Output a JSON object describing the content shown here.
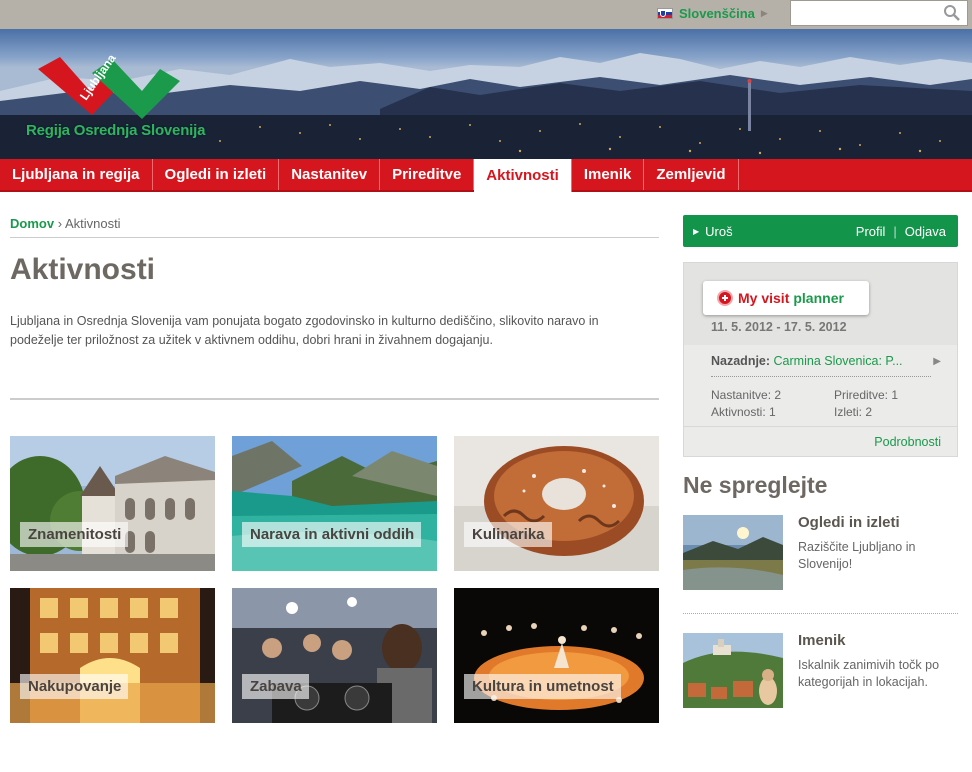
{
  "topbar": {
    "language": "Slovenščina",
    "search_placeholder": ""
  },
  "banner": {
    "logo_word": "Ljubljana",
    "logo_caption": "Regija Osrednja Slovenija"
  },
  "nav": {
    "items": [
      {
        "label": "Ljubljana in regija",
        "active": false
      },
      {
        "label": "Ogledi in izleti",
        "active": false
      },
      {
        "label": "Nastanitev",
        "active": false
      },
      {
        "label": "Prireditve",
        "active": false
      },
      {
        "label": "Aktivnosti",
        "active": true
      },
      {
        "label": "Imenik",
        "active": false
      },
      {
        "label": "Zemljevid",
        "active": false
      }
    ]
  },
  "breadcrumb": {
    "home": "Domov",
    "separator": "›",
    "current": "Aktivnosti"
  },
  "main": {
    "title": "Aktivnosti",
    "intro": "Ljubljana in Osrednja Slovenija vam ponujata bogato zgodovinsko in kulturno dediščino, slikovito naravo in podeželje ter priložnost za užitek v aktivnem oddihu, dobri hrani in živahnem dogajanju.",
    "tiles": [
      {
        "label": "Znamenitosti",
        "image": "building-photo"
      },
      {
        "label": "Narava in aktivni oddih",
        "image": "river-photo"
      },
      {
        "label": "Kulinarika",
        "image": "potica-cake-photo"
      },
      {
        "label": "Nakupovanje",
        "image": "shop-facade-photo"
      },
      {
        "label": "Zabava",
        "image": "dj-party-photo"
      },
      {
        "label": "Kultura in umetnost",
        "image": "dance-stage-photo"
      }
    ]
  },
  "user": {
    "name": "Uroš",
    "profile": "Profil",
    "logout": "Odjava"
  },
  "planner": {
    "brand_red": "My visit",
    "brand_green": "planner",
    "dates": "11. 5. 2012 - 17. 5. 2012",
    "recent_label": "Nazadnje:",
    "recent_value": "Carmina Slovenica: P...",
    "stats": {
      "nastanitve": "Nastanitve: 2",
      "aktivnosti": "Aktivnosti: 1",
      "prireditve": "Prireditve: 1",
      "izleti": "Izleti: 2"
    },
    "details": "Podrobnosti"
  },
  "sidebar": {
    "title": "Ne spreglejte",
    "promos": [
      {
        "title": "Ogledi in izleti",
        "text": "Raziščite Ljubljano in Slovenijo!"
      },
      {
        "title": "Imenik",
        "text": "Iskalnik zanimivih točk po kategorijah in lokacijah."
      }
    ]
  },
  "colors": {
    "brand_red": "#d6161e",
    "brand_green": "#1a9a4a",
    "topbar": "#b5b1a9"
  }
}
